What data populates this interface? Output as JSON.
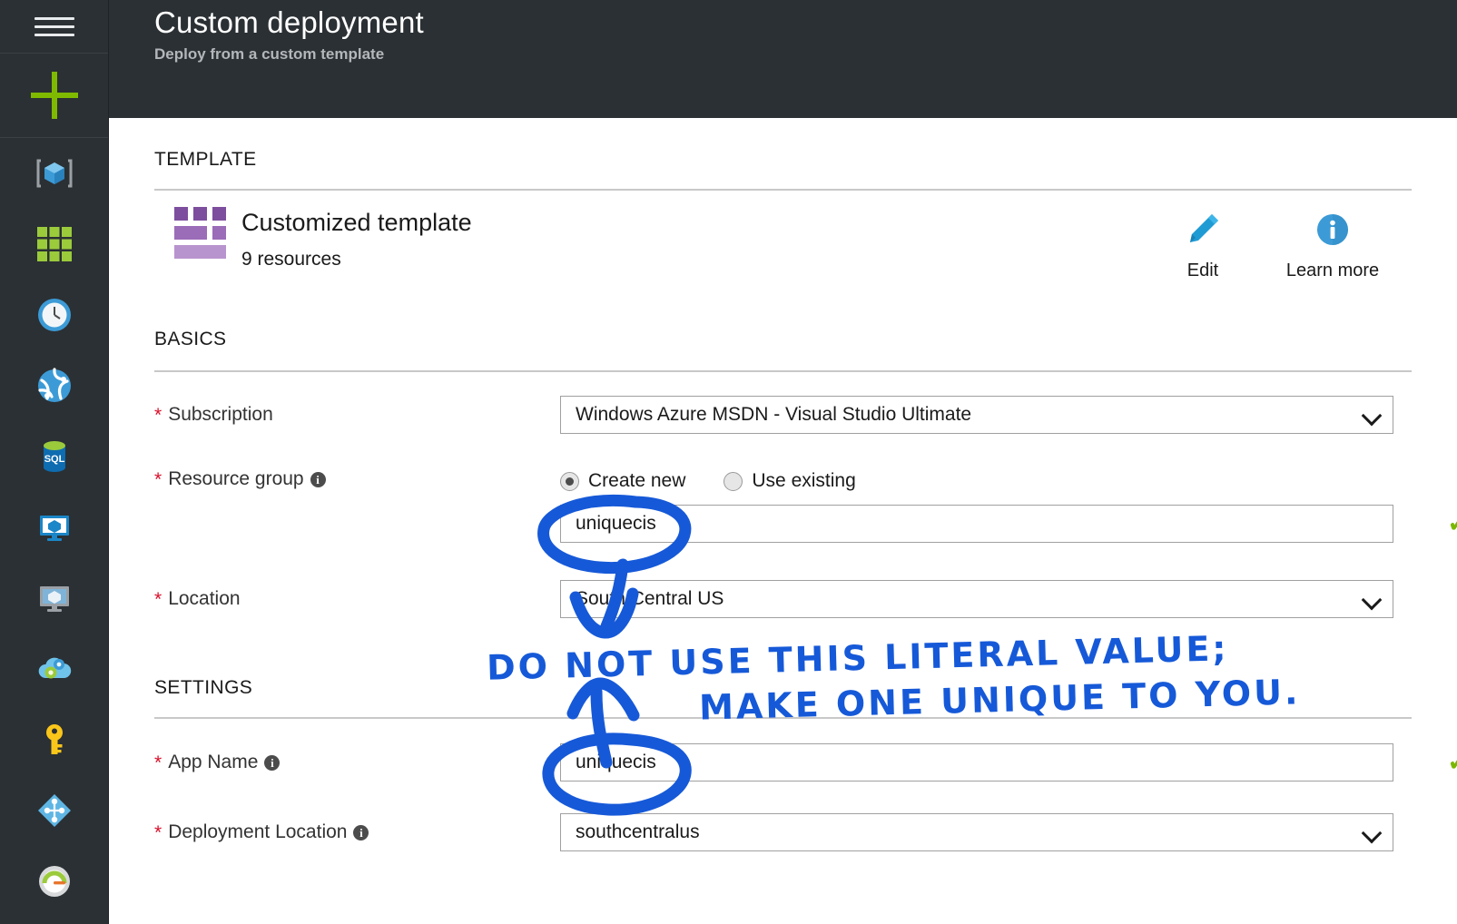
{
  "header": {
    "title": "Custom deployment",
    "subtitle": "Deploy from a custom template"
  },
  "sidebar": {
    "items": [
      {
        "name": "menu-icon",
        "label": "Menu"
      },
      {
        "name": "create-resource-icon",
        "label": "Create a resource"
      },
      {
        "name": "all-resources-icon",
        "label": "All resources"
      },
      {
        "name": "dashboard-icon",
        "label": "Dashboard"
      },
      {
        "name": "recent-icon",
        "label": "Recent"
      },
      {
        "name": "app-services-icon",
        "label": "App Services"
      },
      {
        "name": "sql-databases-icon",
        "label": "SQL databases"
      },
      {
        "name": "virtual-machines-icon",
        "label": "Virtual machines"
      },
      {
        "name": "virtual-machines-classic-icon",
        "label": "Virtual machines (classic)"
      },
      {
        "name": "cloud-services-icon",
        "label": "Cloud services"
      },
      {
        "name": "subscriptions-key-icon",
        "label": "Subscriptions"
      },
      {
        "name": "virtual-networks-icon",
        "label": "Virtual networks"
      },
      {
        "name": "monitor-icon",
        "label": "Monitor"
      }
    ]
  },
  "template_section": {
    "heading": "TEMPLATE",
    "card": {
      "title": "Customized template",
      "subtitle": "9 resources"
    },
    "actions": [
      {
        "name": "edit-action",
        "icon": "pencil-icon",
        "label": "Edit"
      },
      {
        "name": "learn-more-action",
        "icon": "info-circle-icon",
        "label": "Learn more"
      }
    ]
  },
  "basics_section": {
    "heading": "BASICS",
    "fields": {
      "subscription": {
        "label": "Subscription",
        "required": true,
        "value": "Windows Azure MSDN - Visual Studio Ultimate"
      },
      "resource_group": {
        "label": "Resource group",
        "required": true,
        "has_info": true,
        "options": [
          {
            "label": "Create new",
            "selected": true
          },
          {
            "label": "Use existing",
            "selected": false
          }
        ],
        "value": "uniquecis",
        "valid": true
      },
      "location": {
        "label": "Location",
        "required": true,
        "value": "South Central US"
      }
    }
  },
  "settings_section": {
    "heading": "SETTINGS",
    "fields": {
      "app_name": {
        "label": "App Name",
        "required": true,
        "has_info": true,
        "value": "uniquecis",
        "valid": true
      },
      "deployment_location": {
        "label": "Deployment Location",
        "required": true,
        "has_info": true,
        "value": "southcentralus"
      }
    }
  },
  "annotation": {
    "line1": "DO NOT USE THIS LITERAL VALUE;",
    "line2": "MAKE ONE UNIQUE TO YOU.",
    "ink_color": "#1659d8"
  },
  "colors": {
    "chrome_dark": "#2b3034",
    "accent_green": "#7fba00",
    "required_red": "#d9102a",
    "valid_green": "#7ab800",
    "template_purple": "#7d4e9e",
    "info_blue": "#3c9bd6"
  }
}
